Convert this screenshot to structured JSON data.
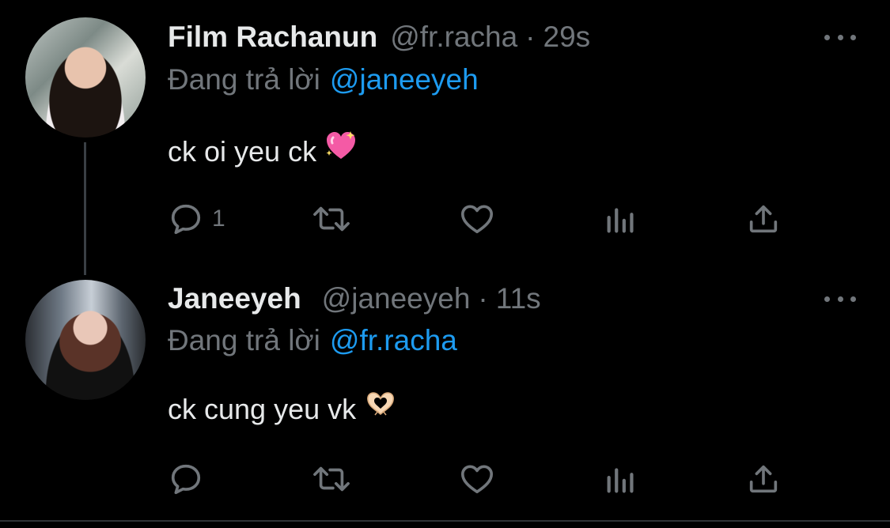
{
  "tweets": [
    {
      "name": "Film Rachanun",
      "handle": "@fr.racha",
      "separator": "·",
      "time": "29s",
      "reply_prefix": "Đang trả lời",
      "reply_to": "@janeeyeh",
      "text": "ck oi yeu ck",
      "emoji": "sparkling-heart",
      "reply_count": "1"
    },
    {
      "name": "Janeeyeh",
      "handle": "@janeeyeh",
      "separator": "·",
      "time": "11s",
      "reply_prefix": "Đang trả lời",
      "reply_to": "@fr.racha",
      "text": "ck cung yeu vk",
      "emoji": "heart-hands",
      "reply_count": ""
    }
  ],
  "colors": {
    "background": "#000000",
    "text": "#e7e9ea",
    "muted": "#71767b",
    "link": "#1d9bf0"
  }
}
